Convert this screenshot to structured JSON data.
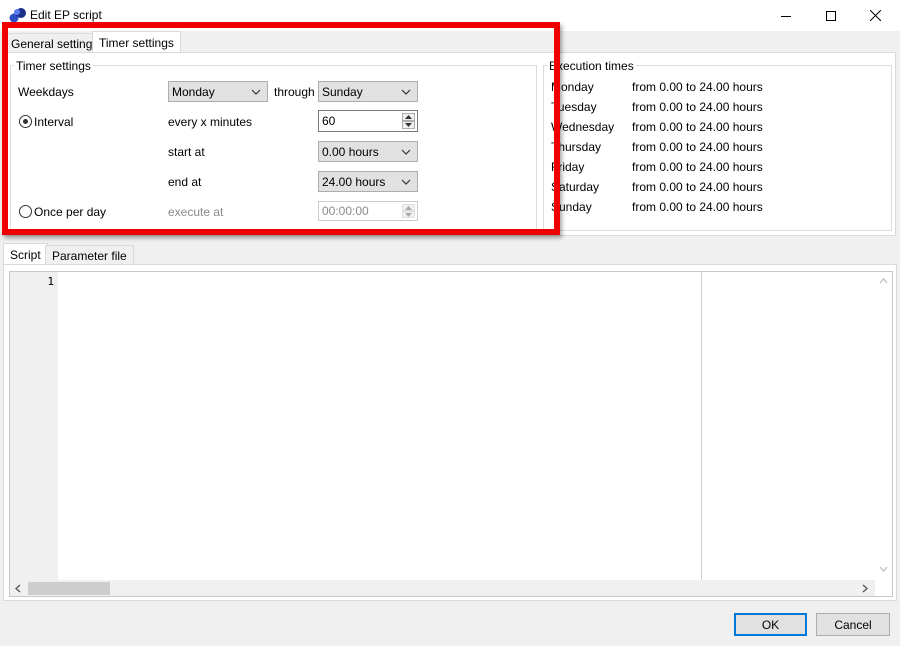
{
  "window": {
    "title": "Edit EP script",
    "accent": "#0078d7"
  },
  "top_tabs": [
    {
      "label": "General settings",
      "active": false
    },
    {
      "label": "Timer settings",
      "active": true
    }
  ],
  "timer_settings": {
    "group_title": "Timer settings",
    "weekdays_label": "Weekdays",
    "from_day": "Monday",
    "through_label": "through",
    "to_day": "Sunday",
    "interval_radio": {
      "label": "Interval",
      "checked": true
    },
    "every_label": "every x minutes",
    "every_value": "60",
    "start_label": "start at",
    "start_value": "0.00 hours",
    "end_label": "end at",
    "end_value": "24.00 hours",
    "once_radio": {
      "label": "Once per day",
      "checked": false
    },
    "execute_label": "execute at",
    "execute_value": "00:00:00"
  },
  "execution_times": {
    "group_title": "Execution times",
    "rows": [
      {
        "day": "Monday",
        "range": "from 0.00 to 24.00 hours"
      },
      {
        "day": "Tuesday",
        "range": "from 0.00 to 24.00 hours"
      },
      {
        "day": "Wednesday",
        "range": "from 0.00 to 24.00 hours"
      },
      {
        "day": "Thursday",
        "range": "from 0.00 to 24.00 hours"
      },
      {
        "day": "Friday",
        "range": "from 0.00 to 24.00 hours"
      },
      {
        "day": "Saturday",
        "range": "from 0.00 to 24.00 hours"
      },
      {
        "day": "Sunday",
        "range": "from 0.00 to 24.00 hours"
      }
    ]
  },
  "bottom_tabs": [
    {
      "label": "Script",
      "active": true
    },
    {
      "label": "Parameter file",
      "active": false
    }
  ],
  "editor": {
    "line_numbers": [
      "1"
    ],
    "content": ""
  },
  "buttons": {
    "ok": "OK",
    "cancel": "Cancel"
  },
  "icons": {
    "window": "ep-script-app-icon",
    "minimize": "minimize-icon",
    "maximize": "maximize-icon",
    "close": "close-icon"
  },
  "annotation_color": "#ee0000"
}
